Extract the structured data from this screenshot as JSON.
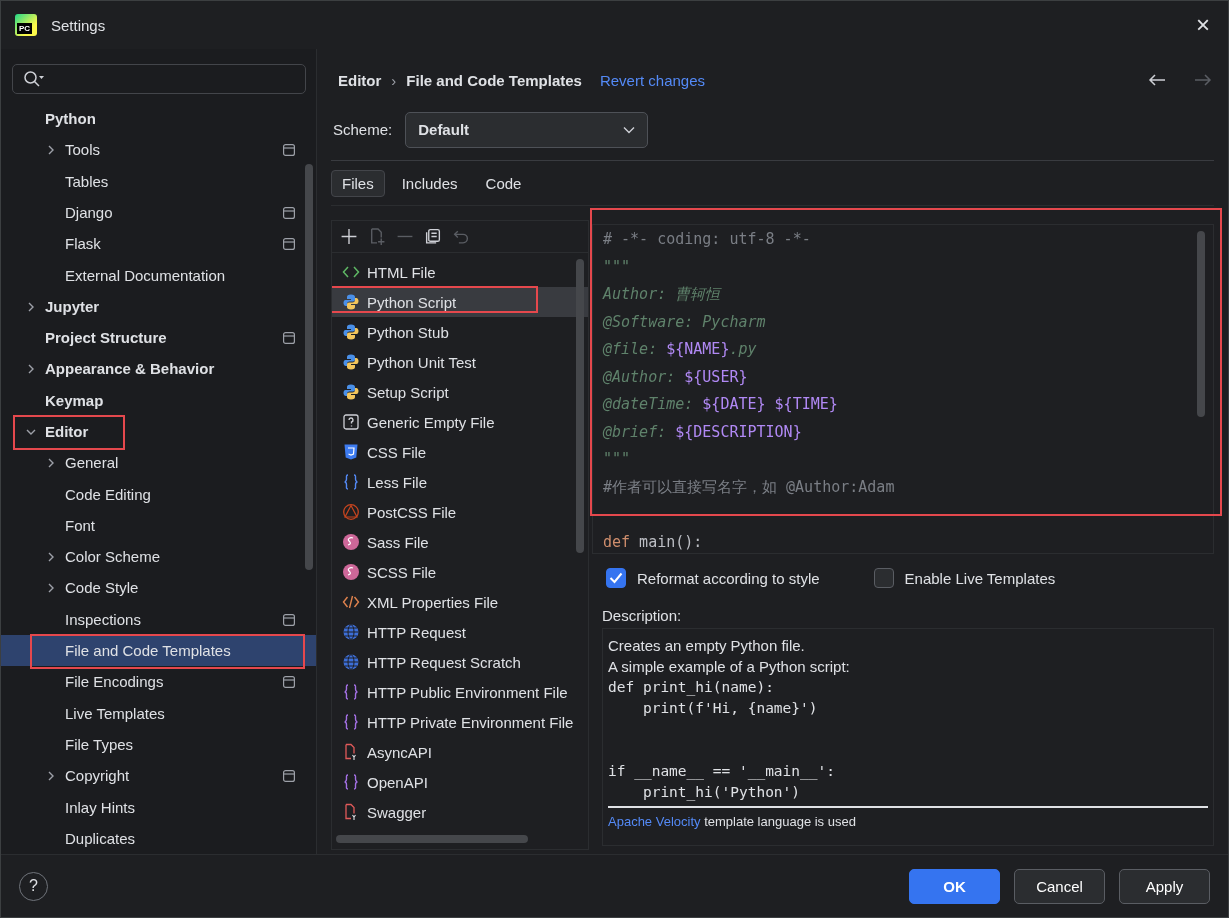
{
  "window": {
    "logo_text": "PC",
    "title": "Settings",
    "close": "×"
  },
  "sidebar": {
    "items": [
      {
        "label": "Python",
        "selected": false,
        "highlighted": false,
        "children": [
          {
            "label": "Tools",
            "selected": false,
            "expanded": false,
            "project_level": true
          },
          {
            "label": "Tables",
            "selected": false
          },
          {
            "label": "Django",
            "selected": false,
            "project_level": true
          },
          {
            "label": "Flask",
            "selected": false,
            "project_level": true
          },
          {
            "label": "External Documentation",
            "selected": false
          }
        ]
      },
      {
        "label": "Jupyter",
        "selected": false,
        "expanded": false
      },
      {
        "label": "Project Structure",
        "selected": false,
        "project_level": true
      },
      {
        "label": "Appearance & Behavior",
        "selected": false,
        "expanded": false
      },
      {
        "label": "Keymap",
        "selected": false
      },
      {
        "label": "Editor",
        "selected": false,
        "expanded": true,
        "highlighted": true,
        "children": [
          {
            "label": "General",
            "selected": false,
            "expanded": false
          },
          {
            "label": "Code Editing",
            "selected": false
          },
          {
            "label": "Font",
            "selected": false
          },
          {
            "label": "Color Scheme",
            "selected": false,
            "expanded": false
          },
          {
            "label": "Code Style",
            "selected": false,
            "expanded": false
          },
          {
            "label": "Inspections",
            "selected": false,
            "project_level": true
          },
          {
            "label": "File and Code Templates",
            "selected": true,
            "highlighted": true
          },
          {
            "label": "File Encodings",
            "selected": false,
            "project_level": true
          },
          {
            "label": "Live Templates",
            "selected": false
          },
          {
            "label": "File Types",
            "selected": false
          },
          {
            "label": "Copyright",
            "selected": false,
            "expanded": false,
            "project_level": true
          },
          {
            "label": "Inlay Hints",
            "selected": false
          },
          {
            "label": "Duplicates",
            "selected": false
          }
        ]
      }
    ]
  },
  "header": {
    "breadcrumb": [
      "Editor",
      "File and Code Templates"
    ],
    "separator": "›",
    "revert_link": "Revert changes",
    "back_enabled": true,
    "forward_enabled": false
  },
  "scheme": {
    "label": "Scheme:",
    "value": "Default"
  },
  "tabs": [
    {
      "label": "Files",
      "selected": true
    },
    {
      "label": "Includes",
      "selected": false
    },
    {
      "label": "Code",
      "selected": false
    }
  ],
  "toolbar": [
    {
      "kind": "add",
      "disabled": false
    },
    {
      "kind": "add-copy",
      "disabled": true
    },
    {
      "kind": "remove",
      "disabled": true
    },
    {
      "kind": "copy",
      "disabled": false
    },
    {
      "kind": "reset",
      "disabled": true
    }
  ],
  "templates": [
    {
      "label": "HTML File",
      "kind": "html",
      "selected": false
    },
    {
      "label": "Python Script",
      "kind": "python",
      "selected": true,
      "highlighted": true
    },
    {
      "label": "Python Stub",
      "kind": "python",
      "selected": false
    },
    {
      "label": "Python Unit Test",
      "kind": "python",
      "selected": false
    },
    {
      "label": "Setup Script",
      "kind": "python",
      "selected": false
    },
    {
      "label": "Generic Empty File",
      "kind": "unknown",
      "selected": false
    },
    {
      "label": "CSS File",
      "kind": "css",
      "selected": false
    },
    {
      "label": "Less File",
      "kind": "less",
      "selected": false
    },
    {
      "label": "PostCSS File",
      "kind": "postcss",
      "selected": false
    },
    {
      "label": "Sass File",
      "kind": "sass",
      "selected": false
    },
    {
      "label": "SCSS File",
      "kind": "sass",
      "selected": false
    },
    {
      "label": "XML Properties File",
      "kind": "xml",
      "selected": false
    },
    {
      "label": "HTTP Request",
      "kind": "http",
      "selected": false
    },
    {
      "label": "HTTP Request Scratch",
      "kind": "http",
      "selected": false
    },
    {
      "label": "HTTP Public Environment File",
      "kind": "env",
      "selected": false
    },
    {
      "label": "HTTP Private Environment File",
      "kind": "env",
      "selected": false
    },
    {
      "label": "AsyncAPI",
      "kind": "api",
      "selected": false
    },
    {
      "label": "OpenAPI",
      "kind": "env",
      "selected": false
    },
    {
      "label": "Swagger",
      "kind": "api",
      "selected": false
    }
  ],
  "editor": {
    "highlighted": true,
    "lines": [
      {
        "kind": "code",
        "tokens": [
          {
            "text": "# -*- coding: utf-8 -*-",
            "kind": "comment"
          }
        ]
      },
      {
        "kind": "code",
        "tokens": [
          {
            "text": "\"\"\"",
            "kind": "docstring"
          }
        ]
      },
      {
        "kind": "code",
        "tokens": [
          {
            "text": "Author: 曹轲恒",
            "kind": "docstring"
          }
        ]
      },
      {
        "kind": "code",
        "tokens": [
          {
            "text": "@Software: Pycharm",
            "kind": "docstring"
          }
        ]
      },
      {
        "kind": "code",
        "tokens": [
          {
            "text": "@file: ",
            "kind": "docstring"
          },
          {
            "text": "${NAME}",
            "kind": "macro"
          },
          {
            "text": ".py",
            "kind": "docstring"
          }
        ]
      },
      {
        "kind": "code",
        "tokens": [
          {
            "text": "@Author: ",
            "kind": "docstring"
          },
          {
            "text": "${USER}",
            "kind": "macro"
          }
        ]
      },
      {
        "kind": "code",
        "tokens": [
          {
            "text": "@dateTime: ",
            "kind": "docstring"
          },
          {
            "text": "${DATE} ${TIME}",
            "kind": "macro"
          }
        ]
      },
      {
        "kind": "code",
        "tokens": [
          {
            "text": "@brief: ",
            "kind": "docstring"
          },
          {
            "text": "${DESCRIPTION}",
            "kind": "macro"
          }
        ]
      },
      {
        "kind": "code",
        "tokens": [
          {
            "text": "\"\"\"",
            "kind": "docstring"
          }
        ]
      },
      {
        "kind": "code",
        "tokens": [
          {
            "text": "#作者可以直接写名字，如 @Author:Adam",
            "kind": "comment"
          }
        ]
      },
      {
        "kind": "blank"
      },
      {
        "kind": "code",
        "tokens": [
          {
            "text": "def",
            "kind": "keyword"
          },
          {
            "text": " main():",
            "kind": "plain"
          }
        ]
      }
    ]
  },
  "options": [
    {
      "label": "Reformat according to style",
      "checked": true
    },
    {
      "label": "Enable Live Templates",
      "checked": false
    }
  ],
  "description": {
    "label": "Description:",
    "lines": [
      {
        "kind": "text",
        "text": "Creates an empty Python file."
      },
      {
        "kind": "text",
        "text": "A simple example of a Python script:"
      },
      {
        "kind": "code",
        "text": "def print_hi(name):"
      },
      {
        "kind": "code",
        "text": "    print(f'Hi, {name}')"
      },
      {
        "kind": "spacer"
      },
      {
        "kind": "spacer"
      },
      {
        "kind": "code",
        "text": "if __name__ == '__main__':"
      },
      {
        "kind": "code",
        "text": "    print_hi('Python')"
      }
    ],
    "footer_link": "Apache Velocity",
    "footer_text": "template language is used"
  },
  "footer": {
    "help": "?",
    "buttons": [
      {
        "label": "OK",
        "primary": true
      },
      {
        "label": "Cancel",
        "primary": false
      },
      {
        "label": "Apply",
        "primary": false
      }
    ]
  }
}
